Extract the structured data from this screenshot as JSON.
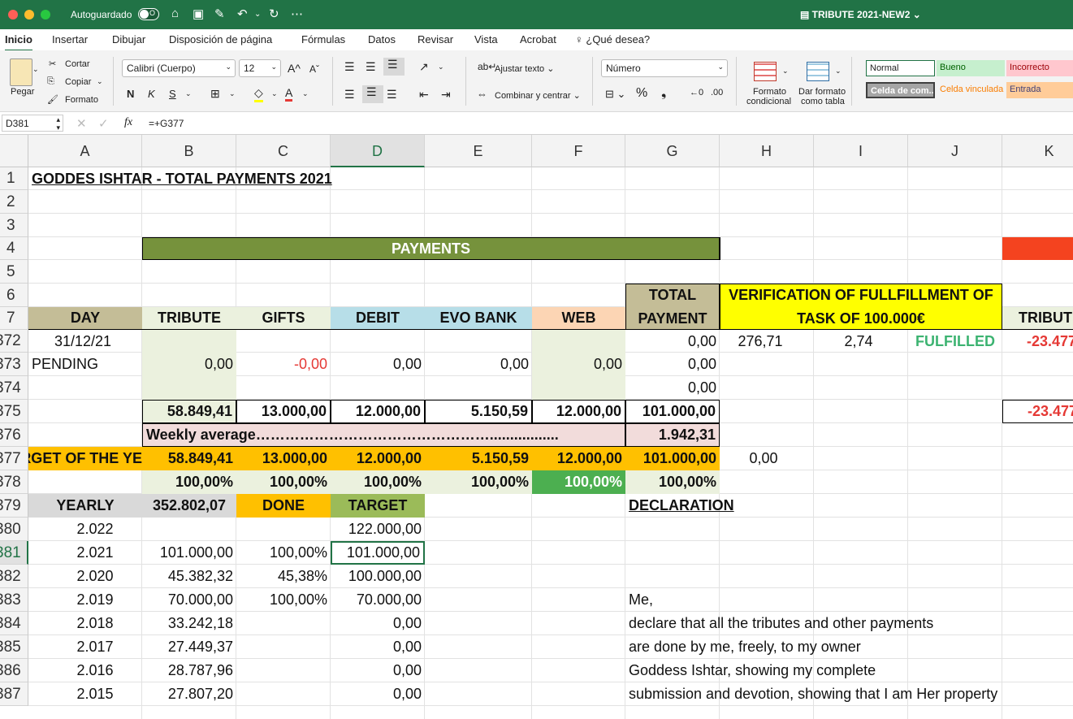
{
  "window": {
    "autosave_label": "Autoguardado",
    "autosave_state": "O",
    "doc_title": "TRIBUTE 2021-NEW2"
  },
  "colors": {
    "excel_green": "#217346",
    "payments_header": "#76923c",
    "tan": "#c4bd97",
    "light_green": "#ebf1de",
    "light_blue": "#b7dee8",
    "peach": "#fcd5b4",
    "yellow": "#ffff00",
    "orange": "#ffc000",
    "pink": "#f2dcdb",
    "green_cell": "#4caf50",
    "red_text": "#e53935",
    "fulfilled_green": "#3cb371",
    "red_fill": "#f4431f",
    "light_gray": "#d9d9d9",
    "gift_orange": "#ffc000",
    "target_green": "#9bbb59"
  },
  "menu": {
    "tabs": [
      "Inicio",
      "Insertar",
      "Dibujar",
      "Disposición de página",
      "Fórmulas",
      "Datos",
      "Revisar",
      "Vista",
      "Acrobat"
    ],
    "tell_me": "¿Qué desea?"
  },
  "ribbon": {
    "paste": "Pegar",
    "cut": "Cortar",
    "copy": "Copiar",
    "format_painter": "Formato",
    "font_name": "Calibri (Cuerpo)",
    "font_size": "12",
    "bold": "N",
    "italic": "K",
    "underline": "S",
    "wrap_text": "Ajustar texto",
    "merge_center": "Combinar y centrar",
    "number_format": "Número",
    "conditional_format_1": "Formato",
    "conditional_format_2": "condicional",
    "table_format_1": "Dar formato",
    "table_format_2": "como tabla",
    "styles": {
      "normal": "Normal",
      "good": "Bueno",
      "bad": "Incorrecto",
      "check_cell": "Celda de com...",
      "linked_cell": "Celda vinculada",
      "input": "Entrada"
    }
  },
  "formula_bar": {
    "name_box": "D381",
    "fx": "fx",
    "formula": "=+G377"
  },
  "columns": [
    "A",
    "B",
    "C",
    "D",
    "E",
    "F",
    "G",
    "H",
    "I",
    "J",
    "K"
  ],
  "active_column": "D",
  "rows_header": [
    "1",
    "2",
    "3",
    "4",
    "5",
    "6",
    "7",
    "372",
    "373",
    "374",
    "375",
    "376",
    "377",
    "378",
    "379",
    "380",
    "381",
    "382",
    "383",
    "384",
    "385",
    "386",
    "387"
  ],
  "active_row": "381",
  "sheet": {
    "title": "GODDES ISHTAR - TOTAL PAYMENTS 2021",
    "payments_header": "PAYMENTS",
    "headers": {
      "day": "DAY",
      "tribute": "TRIBUTE",
      "gifts": "GIFTS",
      "debit": "DEBIT",
      "evo_bank": "EVO BANK",
      "web": "WEB",
      "total_payment_1": "TOTAL",
      "total_payment_2": "PAYMENT",
      "verification_1": "VERIFICATION OF FULLFILLMENT OF",
      "verification_2": "TASK OF 100.000€",
      "k_header": "TRIBUT"
    },
    "row372": {
      "a": "31/12/21",
      "g": "0,00",
      "h": "276,71",
      "i": "2,74",
      "j": "FULFILLED",
      "k": "-23.477"
    },
    "row373": {
      "a": "PENDING",
      "b": "0,00",
      "c": "-0,00",
      "d": "0,00",
      "e": "0,00",
      "f": "0,00",
      "g": "0,00"
    },
    "row374": {
      "g": "0,00"
    },
    "row375": {
      "b": "58.849,41",
      "c": "13.000,00",
      "d": "12.000,00",
      "e": "5.150,59",
      "f": "12.000,00",
      "g": "101.000,00",
      "k": "-23.477"
    },
    "row376": {
      "b": "Weekly average………………………………………….................",
      "g": "1.942,31"
    },
    "row377": {
      "a": "RGET OF THE YE",
      "b": "58.849,41",
      "c": "13.000,00",
      "d": "12.000,00",
      "e": "5.150,59",
      "f": "12.000,00",
      "g": "101.000,00",
      "h": "0,00"
    },
    "row378": {
      "b": "100,00%",
      "c": "100,00%",
      "d": "100,00%",
      "e": "100,00%",
      "f": "100,00%",
      "g": "100,00%"
    },
    "row379": {
      "a": "YEARLY",
      "b": "352.802,07",
      "c": "DONE",
      "d": "TARGET",
      "g": "DECLARATION"
    },
    "yearly": [
      {
        "year": "2.022",
        "value": "",
        "done": "",
        "target": "122.000,00"
      },
      {
        "year": "2.021",
        "value": "101.000,00",
        "done": "100,00%",
        "target": "101.000,00"
      },
      {
        "year": "2.020",
        "value": "45.382,32",
        "done": "45,38%",
        "target": "100.000,00"
      },
      {
        "year": "2.019",
        "value": "70.000,00",
        "done": "100,00%",
        "target": "70.000,00"
      },
      {
        "year": "2.018",
        "value": "33.242,18",
        "done": "",
        "target": "0,00"
      },
      {
        "year": "2.017",
        "value": "27.449,37",
        "done": "",
        "target": "0,00"
      },
      {
        "year": "2.016",
        "value": "28.787,96",
        "done": "",
        "target": "0,00"
      },
      {
        "year": "2.015",
        "value": "27.807,20",
        "done": "",
        "target": "0,00"
      }
    ],
    "declaration": [
      "Me,",
      "declare that all the tributes and other payments",
      "are done by me, freely, to my owner",
      "Goddess Ishtar, showing my complete",
      "submission and devotion, showing that I am Her property"
    ]
  }
}
